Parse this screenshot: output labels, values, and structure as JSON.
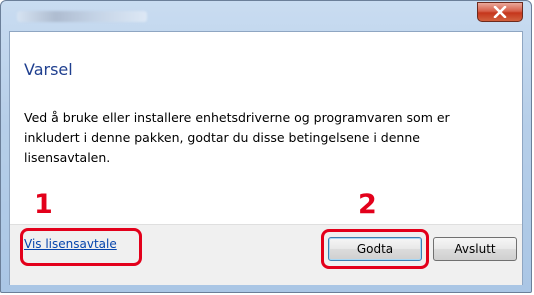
{
  "window": {
    "close_symbol": "x",
    "accent_color": "#e3001b"
  },
  "dialog": {
    "heading": "Varsel",
    "message_lines": [
      "Ved å bruke eller installere enhetsdriverne og programvaren som er",
      "inkludert i denne pakken, godtar du disse betingelsene i denne",
      "lisensavtalen."
    ],
    "link_label": "Vis lisensavtale",
    "accept_label": "Godta",
    "exit_label": "Avslutt"
  },
  "annotations": {
    "marker_1": "1",
    "marker_2": "2"
  }
}
